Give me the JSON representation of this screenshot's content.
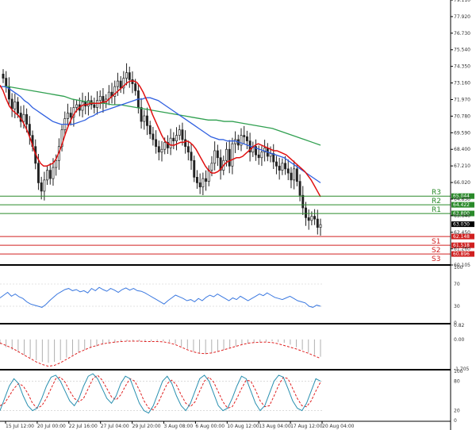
{
  "chart_data": [
    {
      "type": "candlestick",
      "panel": "price",
      "yticks": [
        79.11,
        77.92,
        76.73,
        75.54,
        74.35,
        73.16,
        71.97,
        70.78,
        69.59,
        68.4,
        67.21,
        66.02,
        64.83,
        63.64,
        62.45,
        61.26,
        60.105
      ],
      "ylim": [
        60.105,
        79.11
      ],
      "current_price": "63.030",
      "levels": [
        {
          "name": "R3",
          "value": 65.044,
          "label": "65.044"
        },
        {
          "name": "R2",
          "value": 64.422,
          "label": "64.422"
        },
        {
          "name": "R1",
          "value": 63.8,
          "label": "63.800"
        },
        {
          "name": "S1",
          "value": 62.148,
          "label": "62.148"
        },
        {
          "name": "S2",
          "value": 61.518,
          "label": "61.518"
        },
        {
          "name": "S3",
          "value": 60.896,
          "label": "60.896"
        }
      ],
      "close": [
        73.5,
        72.9,
        72.0,
        71.3,
        71.8,
        71.0,
        70.4,
        70.9,
        70.2,
        69.4,
        68.6,
        67.4,
        66.0,
        65.4,
        66.2,
        66.9,
        66.3,
        67.1,
        67.6,
        68.6,
        69.8,
        70.6,
        71.0,
        70.7,
        71.4,
        71.6,
        71.2,
        71.8,
        71.5,
        71.9,
        71.6,
        71.4,
        71.9,
        72.2,
        71.7,
        72.0,
        72.5,
        72.2,
        72.9,
        73.3,
        72.8,
        73.5,
        73.9,
        73.4,
        73.1,
        72.6,
        71.4,
        70.4,
        70.8,
        70.1,
        69.5,
        69.1,
        68.6,
        68.2,
        68.4,
        68.9,
        68.5,
        69.2,
        69.0,
        69.4,
        69.8,
        69.1,
        68.6,
        68.2,
        67.6,
        66.4,
        66.0,
        65.7,
        66.3,
        66.1,
        66.9,
        67.4,
        68.3,
        67.8,
        66.9,
        67.6,
        68.4,
        67.2,
        68.8,
        69.1,
        68.7,
        69.4,
        69.3,
        69.0,
        68.2,
        68.6,
        68.0,
        67.8,
        68.2,
        68.5,
        67.9,
        68.1,
        67.5,
        67.2,
        66.9,
        67.4,
        67.0,
        66.7,
        66.2,
        67.0,
        66.1,
        65.1,
        64.2,
        63.5,
        63.3,
        63.6,
        63.4,
        62.8,
        63.0
      ],
      "fast_ma": [
        73.0,
        72.6,
        72.0,
        71.5,
        71.2,
        71.0,
        70.8,
        70.5,
        70.1,
        69.6,
        69.0,
        68.3,
        67.8,
        67.4,
        67.2,
        67.2,
        67.3,
        67.4,
        67.7,
        68.2,
        68.8,
        69.5,
        70.1,
        70.6,
        71.0,
        71.3,
        71.5,
        71.6,
        71.6,
        71.7,
        71.7,
        71.7,
        71.7,
        71.8,
        71.8,
        72.0,
        72.2,
        72.4,
        72.6,
        72.8,
        73.0,
        73.2,
        73.3,
        73.3,
        73.2,
        72.9,
        72.5,
        72.0,
        71.5,
        70.9,
        70.4,
        69.9,
        69.4,
        69.0,
        68.8,
        68.7,
        68.7,
        68.8,
        68.9,
        68.9,
        69.0,
        68.9,
        68.7,
        68.4,
        68.0,
        67.6,
        67.2,
        66.9,
        66.7,
        66.7,
        66.8,
        67.0,
        67.3,
        67.5,
        67.6,
        67.7,
        67.8,
        67.8,
        67.9,
        68.1,
        68.3,
        68.5,
        68.7,
        68.8,
        68.7,
        68.6,
        68.5,
        68.4,
        68.3,
        68.3,
        68.2,
        68.1,
        68.0,
        67.8,
        67.6,
        67.4,
        67.2,
        67.0,
        66.8,
        66.5,
        66.2,
        65.8,
        65.4,
        65.0
      ],
      "mid_ma": [
        72.9,
        72.9,
        72.8,
        72.6,
        72.4,
        72.2,
        71.9,
        71.7,
        71.4,
        71.2,
        71.0,
        70.8,
        70.6,
        70.4,
        70.3,
        70.2,
        70.2,
        70.2,
        70.2,
        70.3,
        70.4,
        70.5,
        70.7,
        70.8,
        71.0,
        71.1,
        71.2,
        71.3,
        71.4,
        71.5,
        71.6,
        71.7,
        71.8,
        71.9,
        72.0,
        72.0,
        72.1,
        72.1,
        72.0,
        71.9,
        71.7,
        71.5,
        71.3,
        71.1,
        70.9,
        70.7,
        70.5,
        70.3,
        70.1,
        69.9,
        69.7,
        69.5,
        69.3,
        69.2,
        69.1,
        69.1,
        69.0,
        69.0,
        69.0,
        68.9,
        68.8,
        68.7,
        68.6,
        68.5,
        68.4,
        68.3,
        68.2,
        68.1,
        68.0,
        67.9,
        67.8,
        67.6,
        67.4,
        67.2,
        67.0,
        66.8,
        66.6,
        66.4,
        66.2,
        66.0
      ],
      "slow_ma": [
        72.9,
        72.9,
        72.8,
        72.7,
        72.6,
        72.5,
        72.4,
        72.3,
        72.2,
        72.0,
        71.9,
        71.8,
        71.7,
        71.7,
        71.6,
        71.6,
        71.5,
        71.4,
        71.3,
        71.2,
        71.1,
        71.0,
        70.9,
        70.8,
        70.7,
        70.6,
        70.5,
        70.5,
        70.4,
        70.4,
        70.3,
        70.2,
        70.1,
        70.0,
        69.9,
        69.7,
        69.5,
        69.3,
        69.1,
        68.9,
        68.7
      ],
      "xtick_labels": [
        "15 Jul 12:00",
        "20 Jul 00:00",
        "22 Jul 16:00",
        "27 Jul 04:00",
        "29 Jul 20:00",
        "3 Aug 08:00",
        "6 Aug 00:00",
        "10 Aug 12:00",
        "13 Aug 04:00",
        "17 Aug 12:00",
        "20 Aug 04:00"
      ],
      "colors": {
        "fast_ma": "#e01010",
        "mid_ma": "#3060e0",
        "slow_ma": "#30a050",
        "resistance": "#2a8a2a",
        "support": "#d02020",
        "candle": "#222222"
      }
    },
    {
      "type": "line",
      "panel": "rsi",
      "yticks": [
        100,
        70,
        30,
        0
      ],
      "ylim": [
        0,
        100
      ],
      "values": [
        45,
        50,
        55,
        48,
        52,
        47,
        44,
        38,
        34,
        32,
        30,
        28,
        33,
        40,
        46,
        52,
        56,
        60,
        62,
        58,
        60,
        56,
        58,
        54,
        62,
        58,
        64,
        60,
        57,
        62,
        59,
        55,
        60,
        63,
        59,
        62,
        58,
        57,
        54,
        50,
        46,
        42,
        38,
        34,
        40,
        45,
        50,
        47,
        44,
        40,
        42,
        38,
        44,
        40,
        46,
        50,
        47,
        52,
        48,
        44,
        40,
        45,
        42,
        48,
        44,
        40,
        44,
        48,
        52,
        49,
        54,
        50,
        46,
        44,
        42,
        45,
        48,
        44,
        40,
        38,
        36,
        30,
        28,
        32,
        30
      ]
    },
    {
      "type": "bar+line",
      "panel": "macd",
      "yticks": [
        0.82,
        0.0,
        -1.705
      ],
      "ylim": [
        -1.705,
        0.82
      ],
      "histogram": [
        -0.3,
        -0.45,
        -0.6,
        -0.75,
        -0.9,
        -1.05,
        -1.2,
        -1.3,
        -1.35,
        -1.3,
        -1.2,
        -1.05,
        -0.9,
        -0.75,
        -0.6,
        -0.5,
        -0.4,
        -0.3,
        -0.25,
        -0.2,
        -0.15,
        -0.1,
        -0.08,
        -0.1,
        -0.12,
        -0.1,
        -0.08,
        -0.1,
        -0.15,
        -0.25,
        -0.4,
        -0.55,
        -0.7,
        -0.8,
        -0.85,
        -0.8,
        -0.7,
        -0.6,
        -0.5,
        -0.4,
        -0.3,
        -0.25,
        -0.2,
        -0.15,
        -0.12,
        -0.1,
        -0.15,
        -0.2,
        -0.3,
        -0.45,
        -0.6,
        -0.75,
        -0.9,
        -1.0
      ],
      "signal": [
        -0.2,
        -0.35,
        -0.5,
        -0.7,
        -0.9,
        -1.1,
        -1.3,
        -1.45,
        -1.55,
        -1.5,
        -1.35,
        -1.15,
        -0.95,
        -0.75,
        -0.6,
        -0.45,
        -0.35,
        -0.25,
        -0.2,
        -0.15,
        -0.12,
        -0.1,
        -0.1,
        -0.1,
        -0.12,
        -0.12,
        -0.12,
        -0.14,
        -0.2,
        -0.3,
        -0.45,
        -0.6,
        -0.72,
        -0.8,
        -0.82,
        -0.78,
        -0.7,
        -0.6,
        -0.5,
        -0.4,
        -0.3,
        -0.22,
        -0.18,
        -0.16,
        -0.15,
        -0.18,
        -0.25,
        -0.35,
        -0.45,
        -0.55,
        -0.68,
        -0.8,
        -0.95,
        -1.1
      ]
    },
    {
      "type": "line",
      "panel": "stochastic",
      "yticks": [
        100,
        80,
        20,
        0
      ],
      "ylim": [
        0,
        100
      ],
      "k": [
        20,
        45,
        70,
        85,
        75,
        50,
        30,
        20,
        25,
        45,
        70,
        88,
        92,
        80,
        60,
        40,
        30,
        45,
        70,
        90,
        95,
        85,
        65,
        45,
        35,
        50,
        75,
        90,
        85,
        60,
        35,
        20,
        15,
        30,
        55,
        80,
        90,
        75,
        50,
        30,
        20,
        35,
        60,
        85,
        92,
        80,
        55,
        30,
        20,
        25,
        45,
        70,
        90,
        85,
        60,
        35,
        20,
        30,
        55,
        80,
        92,
        88,
        65,
        40,
        25,
        20,
        35,
        60,
        85,
        80
      ],
      "d": [
        30,
        35,
        50,
        65,
        75,
        70,
        55,
        35,
        25,
        30,
        45,
        65,
        85,
        88,
        78,
        60,
        45,
        38,
        45,
        65,
        85,
        92,
        82,
        65,
        48,
        42,
        52,
        70,
        85,
        80,
        62,
        40,
        25,
        22,
        35,
        55,
        75,
        82,
        72,
        52,
        35,
        28,
        38,
        60,
        80,
        88,
        78,
        58,
        38,
        25,
        28,
        45,
        65,
        82,
        80,
        62,
        40,
        28,
        30,
        50,
        72,
        88,
        85,
        65,
        45,
        30,
        28,
        40,
        60,
        78
      ]
    }
  ]
}
